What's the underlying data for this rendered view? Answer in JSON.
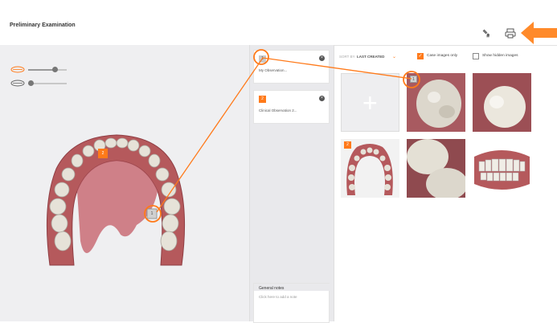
{
  "header": {
    "title": "Preliminary Examination",
    "icons": [
      "tooth-tool-icon",
      "print-icon",
      "close-icon"
    ]
  },
  "observations": [
    {
      "number": "1",
      "text": "My Observation..."
    },
    {
      "number": "2",
      "text": "Clinical Observation 2..."
    }
  ],
  "general_notes": {
    "title": "General notes",
    "placeholder": "Click here to add a note"
  },
  "gallery": {
    "sort_label": "SORT BY",
    "sort_value": "LAST CREATED",
    "case_images_only": "Case images only",
    "case_images_checked": true,
    "show_hidden": "Show hidden images",
    "show_hidden_checked": false,
    "image_badges": [
      "1",
      "2"
    ]
  },
  "model_markers": [
    "2",
    "1"
  ],
  "colors": {
    "accent": "#ff7a1a",
    "gum": "#b5595c",
    "tooth": "#e6e2d8"
  }
}
